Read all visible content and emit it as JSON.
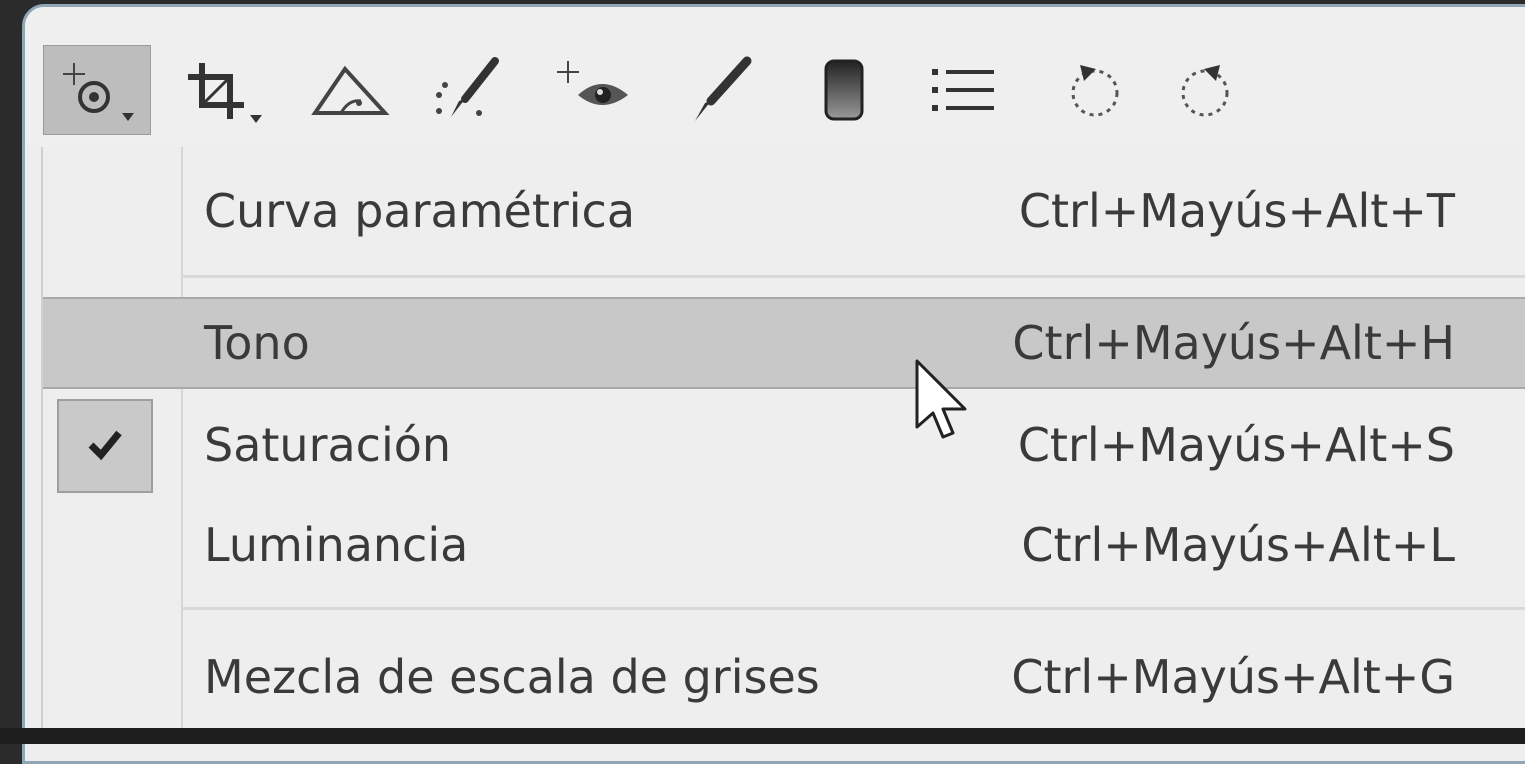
{
  "toolbar": {
    "tools": [
      {
        "icon": "targeted-adjustment-icon",
        "active": true
      },
      {
        "icon": "crop-icon",
        "active": false
      },
      {
        "icon": "straighten-icon",
        "active": false
      },
      {
        "icon": "spot-removal-icon",
        "active": false
      },
      {
        "icon": "red-eye-icon",
        "active": false
      },
      {
        "icon": "adjustment-brush-icon",
        "active": false
      },
      {
        "icon": "graduated-filter-icon",
        "active": false
      },
      {
        "icon": "list-icon",
        "active": false
      },
      {
        "icon": "rotate-left-icon",
        "active": false
      },
      {
        "icon": "rotate-right-icon",
        "active": false
      }
    ]
  },
  "menu": {
    "items": [
      {
        "label": "Curva paramétrica",
        "shortcut": "Ctrl+Mayús+Alt+T",
        "checked": false,
        "highlighted": false
      },
      {
        "label": "Tono",
        "shortcut": "Ctrl+Mayús+Alt+H",
        "checked": false,
        "highlighted": true
      },
      {
        "label": "Saturación",
        "shortcut": "Ctrl+Mayús+Alt+S",
        "checked": true,
        "highlighted": false
      },
      {
        "label": "Luminancia",
        "shortcut": "Ctrl+Mayús+Alt+L",
        "checked": false,
        "highlighted": false
      },
      {
        "label": "Mezcla de escala de grises",
        "shortcut": "Ctrl+Mayús+Alt+G",
        "checked": false,
        "highlighted": false
      }
    ]
  },
  "colors": {
    "menu_background": "#eeeeee",
    "highlight": "#c8c8c8",
    "window_border": "#8fa6b6",
    "text": "#3a3a3a"
  }
}
